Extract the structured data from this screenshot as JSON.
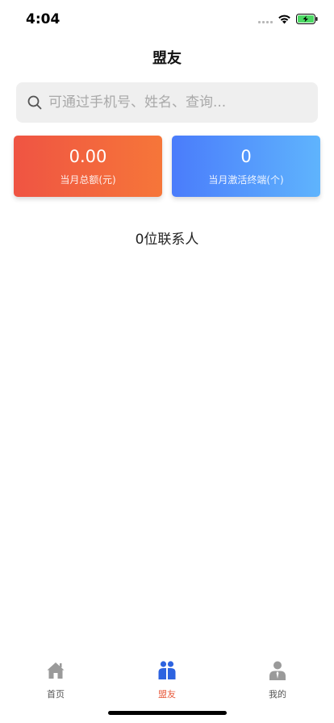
{
  "status_bar": {
    "time": "4:04"
  },
  "header": {
    "title": "盟友"
  },
  "search": {
    "placeholder": "可通过手机号、姓名、查询..."
  },
  "stats": [
    {
      "value": "0.00",
      "label": "当月总额(元)",
      "color": "#ef5443"
    },
    {
      "value": "0",
      "label": "当月激活终端(个)",
      "color": "#4a7cfb"
    }
  ],
  "contacts": {
    "summary": "0位联系人"
  },
  "tabs": [
    {
      "label": "首页",
      "icon": "home-icon",
      "active": false
    },
    {
      "label": "盟友",
      "icon": "friends-icon",
      "active": true
    },
    {
      "label": "我的",
      "icon": "person-icon",
      "active": false
    }
  ],
  "colors": {
    "accent": "#e85a3c",
    "card_red": "#ef5443",
    "card_blue": "#4a7cfb"
  }
}
